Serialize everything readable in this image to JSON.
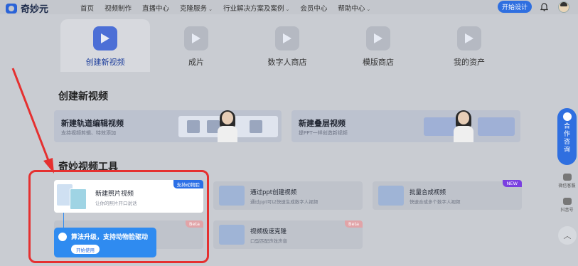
{
  "app": {
    "brand": "奇妙元"
  },
  "nav": {
    "items": [
      "首页",
      "视频制作",
      "直播中心",
      "克隆服务",
      "行业解决方案及案例",
      "会员中心",
      "帮助中心"
    ],
    "chevron": "⌄",
    "start_label": "开始设计",
    "vip_label": "",
    "avatar_tag": ""
  },
  "categories": [
    {
      "label": "创建新视频",
      "icon": "video-create-icon",
      "active": true
    },
    {
      "label": "成片",
      "icon": "film-icon",
      "active": false
    },
    {
      "label": "数字人商店",
      "icon": "digital-human-icon",
      "active": false
    },
    {
      "label": "模版商店",
      "icon": "template-icon",
      "active": false
    },
    {
      "label": "我的资产",
      "icon": "asset-icon",
      "active": false
    }
  ],
  "create_section": {
    "title": "创建新视频",
    "cards": [
      {
        "title": "新建轨道编辑视频",
        "sub": "支持视频剪辑、特效添加"
      },
      {
        "title": "新建叠层视频",
        "sub": "提PPT一样创造新视频"
      }
    ]
  },
  "tools_section": {
    "title": "奇妙视频工具",
    "cards": [
      {
        "title": "新建照片视频",
        "sub": "让你的照片开口说话",
        "tag": "支持动物脸"
      },
      {
        "title": "通过ppt创建视频",
        "sub": "通过ppt可以快速生成数字人视频"
      },
      {
        "title": "批量合成视频",
        "sub": "快速合成多个数字人视频",
        "tag": "NEW"
      },
      {
        "title": "",
        "sub": "",
        "tag": "Beta"
      },
      {
        "title": "视频极速克隆",
        "sub": "口型匹配声效声音",
        "tag": "Beta"
      }
    ]
  },
  "popup": {
    "text": "算法升级，支持动物脸驱动",
    "button": "开始使用"
  },
  "rail": {
    "consult": [
      "合",
      "作",
      "咨",
      "询"
    ],
    "wechat": "微信客服",
    "douyin": "抖音号",
    "back_top": "︿"
  },
  "colors": {
    "accent": "#2f6fe0",
    "highlight_box": "#e53030",
    "popup": "#2f8bf0"
  }
}
